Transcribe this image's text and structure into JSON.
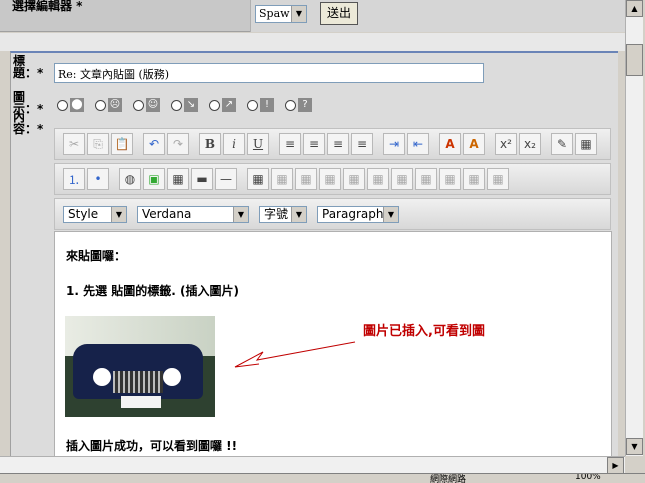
{
  "top": {
    "label": "選擇編輯器 *",
    "editor_value": "Spaw",
    "submit_label": "送出"
  },
  "form": {
    "title_label": "標題：*",
    "title_value": "Re: 文章內貼圖 (版務)",
    "icon_label": "圖示：*",
    "content_label": "內容：*",
    "icons": [
      "⬤",
      "☹",
      "☺",
      "↘",
      "↗",
      "!",
      "?"
    ]
  },
  "toolbar": {
    "row1": [
      "✂",
      "⎘",
      "📋",
      "↶",
      "↷",
      "B",
      "i",
      "U",
      "≡",
      "≡",
      "≡",
      "≡",
      "⇥",
      "⇤",
      "A",
      "A",
      "x²",
      "x₂",
      "✎",
      "▦"
    ],
    "row2": [
      "⒈",
      "•",
      "◍",
      "▣",
      "▦",
      "▬",
      "—",
      "▦",
      "▦",
      "▦",
      "▦",
      "▦",
      "▦",
      "▦",
      "▦",
      "▦",
      "▦",
      "▦"
    ],
    "style": "Style",
    "font": "Verdana",
    "size": "字號",
    "paragraph": "Paragraph"
  },
  "content": {
    "line1": "來貼圖囉：",
    "line2": "1. 先選 貼圖的標籤. (插入圖片)",
    "note": "圖片已插入,可看到圖",
    "line3": "插入圖片成功，可以看到圖囉 !!"
  },
  "status": {
    "zone": "網際網路",
    "zoom": "100%"
  },
  "colors": {
    "note_red": "#c00000",
    "panel_border": "#6a84b7"
  }
}
